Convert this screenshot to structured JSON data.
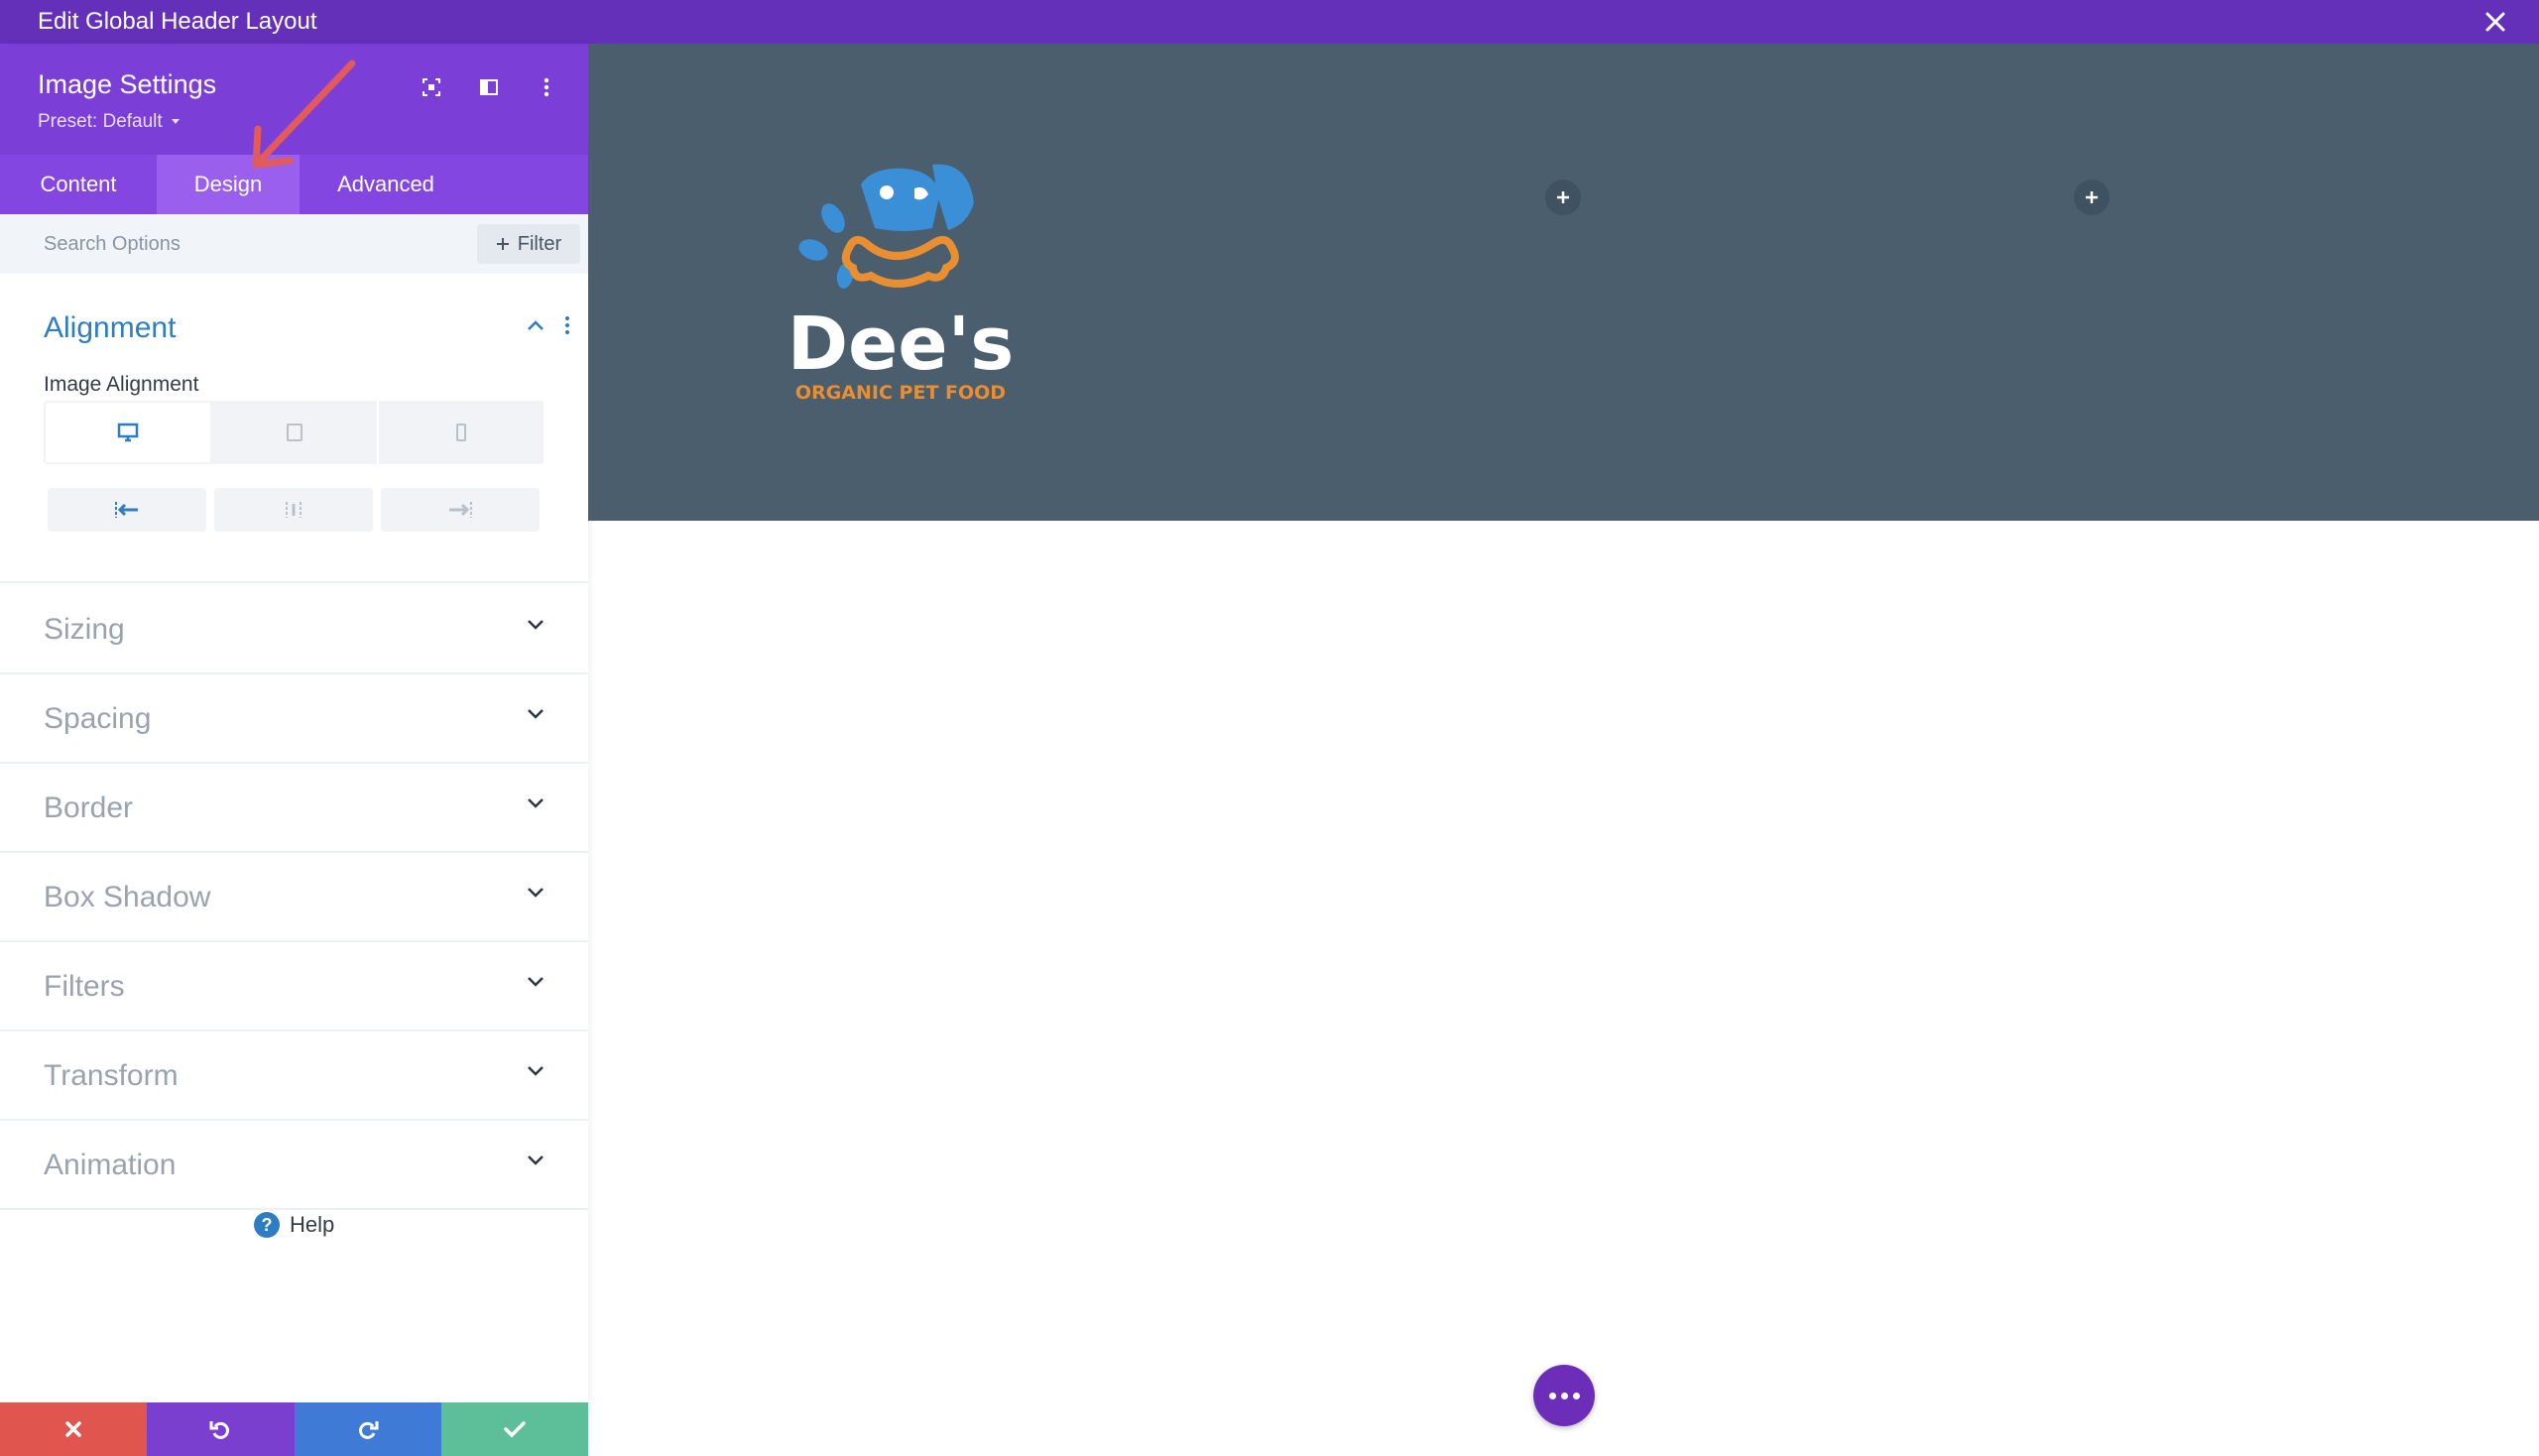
{
  "window": {
    "title": "Edit Global Header Layout"
  },
  "panel": {
    "title": "Image Settings",
    "preset": "Preset: Default",
    "tabs": [
      {
        "label": "Content",
        "active": false
      },
      {
        "label": "Design",
        "active": true
      },
      {
        "label": "Advanced",
        "active": false
      }
    ],
    "search": {
      "placeholder": "Search Options",
      "filter_label": "Filter"
    },
    "alignment": {
      "title": "Alignment",
      "option_label": "Image Alignment",
      "devices": [
        "desktop-icon",
        "tablet-icon",
        "phone-icon"
      ],
      "options": [
        "align-left-icon",
        "align-center-icon",
        "align-right-icon"
      ],
      "selected": "align-left-icon"
    },
    "sections": [
      "Sizing",
      "Spacing",
      "Border",
      "Box Shadow",
      "Filters",
      "Transform",
      "Animation"
    ],
    "help_label": "Help"
  },
  "bottom_bar": {
    "buttons": [
      {
        "name": "discard-button",
        "icon": "x-icon",
        "color": "#e0564f"
      },
      {
        "name": "undo-button",
        "icon": "undo-icon",
        "color": "#7a3fcf"
      },
      {
        "name": "redo-button",
        "icon": "redo-icon",
        "color": "#3f7bd6"
      },
      {
        "name": "save-button",
        "icon": "check-icon",
        "color": "#5dbf9a"
      }
    ]
  },
  "preview": {
    "logo": {
      "name": "Dee's",
      "tagline": "ORGANIC PET FOOD"
    },
    "header_bg": "#4a5e6e"
  },
  "colors": {
    "brand": "#6430b9",
    "accent_blue": "#2e7cc1",
    "logo_blue": "#3b8fd6",
    "logo_orange": "#e98f32"
  }
}
